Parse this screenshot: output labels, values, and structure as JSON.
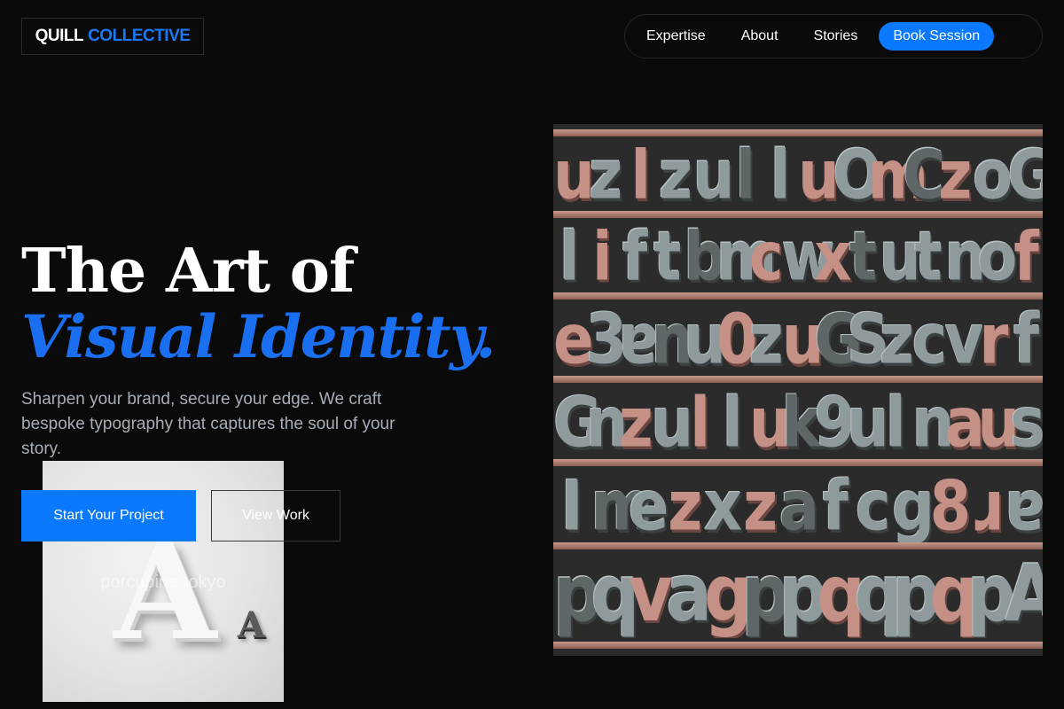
{
  "brand": {
    "name_part1": "QUILL",
    "name_part2": "COLLECTIVE"
  },
  "nav": {
    "links": [
      "Expertise",
      "About",
      "Stories"
    ],
    "cta": "Book Session"
  },
  "hero": {
    "title_line1": "The Art of",
    "title_line2": "Visual Identity.",
    "subtitle": "Sharpen your brand, secure your edge. We craft bespoke typography that captures the soul of your story.",
    "primary_button": "Start Your Project",
    "secondary_button": "View Work"
  },
  "images": {
    "floating_card_watermark": "porcupine tokyo"
  },
  "colors": {
    "accent": "#0a78ff",
    "title_accent": "#1a6ff0",
    "background": "#0a0a0a"
  }
}
